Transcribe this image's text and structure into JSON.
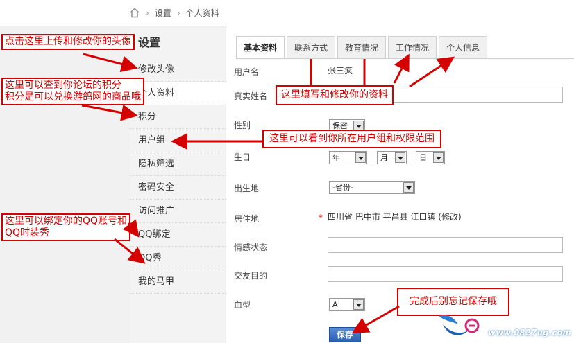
{
  "breadcrumb": {
    "items": [
      "设置",
      "个人资料"
    ]
  },
  "sidebar": {
    "title": "设置",
    "items": [
      {
        "label": "修改头像"
      },
      {
        "label": "个人资料"
      },
      {
        "label": "积分"
      },
      {
        "label": "用户组"
      },
      {
        "label": "隐私筛选"
      },
      {
        "label": "密码安全"
      },
      {
        "label": "访问推广"
      },
      {
        "label": "QQ绑定"
      },
      {
        "label": "QQ秀"
      },
      {
        "label": "我的马甲"
      }
    ]
  },
  "tabs": [
    {
      "label": "基本资料",
      "active": true
    },
    {
      "label": "联系方式"
    },
    {
      "label": "教育情况"
    },
    {
      "label": "工作情况"
    },
    {
      "label": "个人信息"
    }
  ],
  "form": {
    "username_label": "用户名",
    "username_value": "张三疯",
    "realname_label": "真实姓名",
    "gender_label": "性别",
    "gender_value": "保密",
    "birthday_label": "生日",
    "birth_year": "年",
    "birth_month": "月",
    "birth_day": "日",
    "birthplace_label": "出生地",
    "birthplace_value": "-省份-",
    "residence_label": "居住地",
    "residence_star": "*",
    "residence_value": "四川省 巴中市 平昌县 江口镇 (修改)",
    "emotion_label": "情感状态",
    "purpose_label": "交友目的",
    "blood_label": "血型",
    "blood_value": "A",
    "save_label": "保存"
  },
  "annotations": {
    "avatar": "点击这里上传和修改你的头像",
    "credits_line1": "这里可以查到你论坛的积分",
    "credits_line2": "积分是可以兑换游鸽网的商品哦",
    "edit_profile": "这里填写和修改你的资料",
    "usergroup": "这里可以看到你所在用户组和权限范围",
    "qq_line1": "这里可以绑定你的QQ账号和",
    "qq_line2": "QQ时装秀",
    "save": "完成后别忘记保存哦"
  },
  "watermark": {
    "text": "www.0827ug.com"
  },
  "colors": {
    "annotation": "#d40000",
    "save_button": "#2a5db0"
  }
}
